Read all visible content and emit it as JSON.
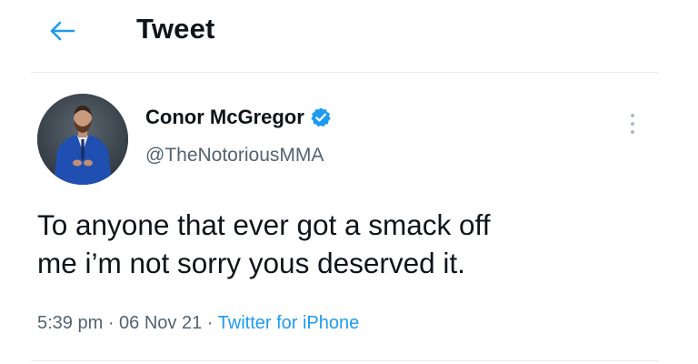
{
  "header": {
    "title": "Tweet",
    "back_icon": "arrow-left-icon"
  },
  "author": {
    "name": "Conor McGregor",
    "handle": "@TheNotoriousMMA",
    "verified": true,
    "verified_icon": "verified-badge-icon"
  },
  "tweet": {
    "line1": "To anyone that ever got a smack off",
    "line2": "me i’m not sorry yous deserved it.",
    "time": "5:39 pm",
    "separator": " · ",
    "date": "06 Nov 21",
    "source": "Twitter for iPhone"
  },
  "colors": {
    "accent": "#1d9bf0",
    "text": "#0f1419",
    "secondary": "#536471",
    "divider": "#e6ecf0"
  }
}
